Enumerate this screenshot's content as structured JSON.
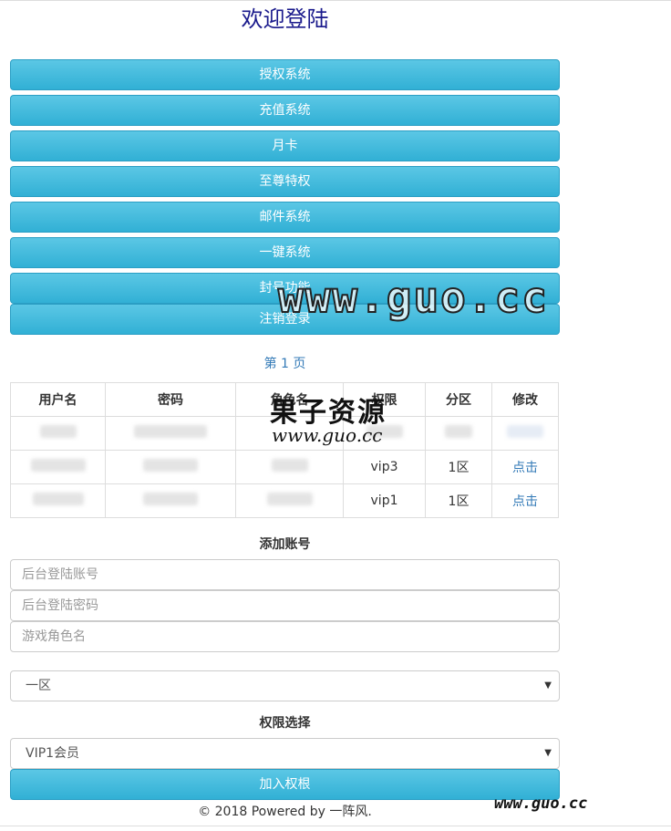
{
  "page": {
    "title": "欢迎登陆",
    "nav": [
      "授权系统",
      "充值系统",
      "月卡",
      "至尊特权",
      "邮件系统",
      "一键系统",
      "封号功能",
      "注销登录"
    ],
    "pagination_label": "第 1 页"
  },
  "table": {
    "headers": [
      "用户名",
      "密码",
      "角色名",
      "权限",
      "分区",
      "修改"
    ],
    "rows": [
      {
        "username": "",
        "password": "",
        "role": "",
        "permission": "",
        "zone": "",
        "action": ""
      },
      {
        "username": "",
        "password": "",
        "role": "",
        "permission": "vip3",
        "zone": "1区",
        "action": "点击"
      },
      {
        "username": "",
        "password": "",
        "role": "",
        "permission": "vip1",
        "zone": "1区",
        "action": "点击"
      }
    ]
  },
  "add_account": {
    "heading": "添加账号",
    "account_placeholder": "后台登陆账号",
    "password_placeholder": "后台登陆密码",
    "role_placeholder": "游戏角色名",
    "zone_selected": "一区",
    "permission_heading": "权限选择",
    "permission_selected": "VIP1会员",
    "submit_label": "加入权根"
  },
  "footer": {
    "text": "© 2018 Powered by 一阵风."
  },
  "watermark": {
    "big": "www.guo.cc",
    "cn": "果子资源",
    "url": "www.guo.cc",
    "foot": "www.guo.cc"
  },
  "colors": {
    "button": "#31b0d5",
    "title": "#1a1a8c",
    "link": "#337ab7"
  }
}
